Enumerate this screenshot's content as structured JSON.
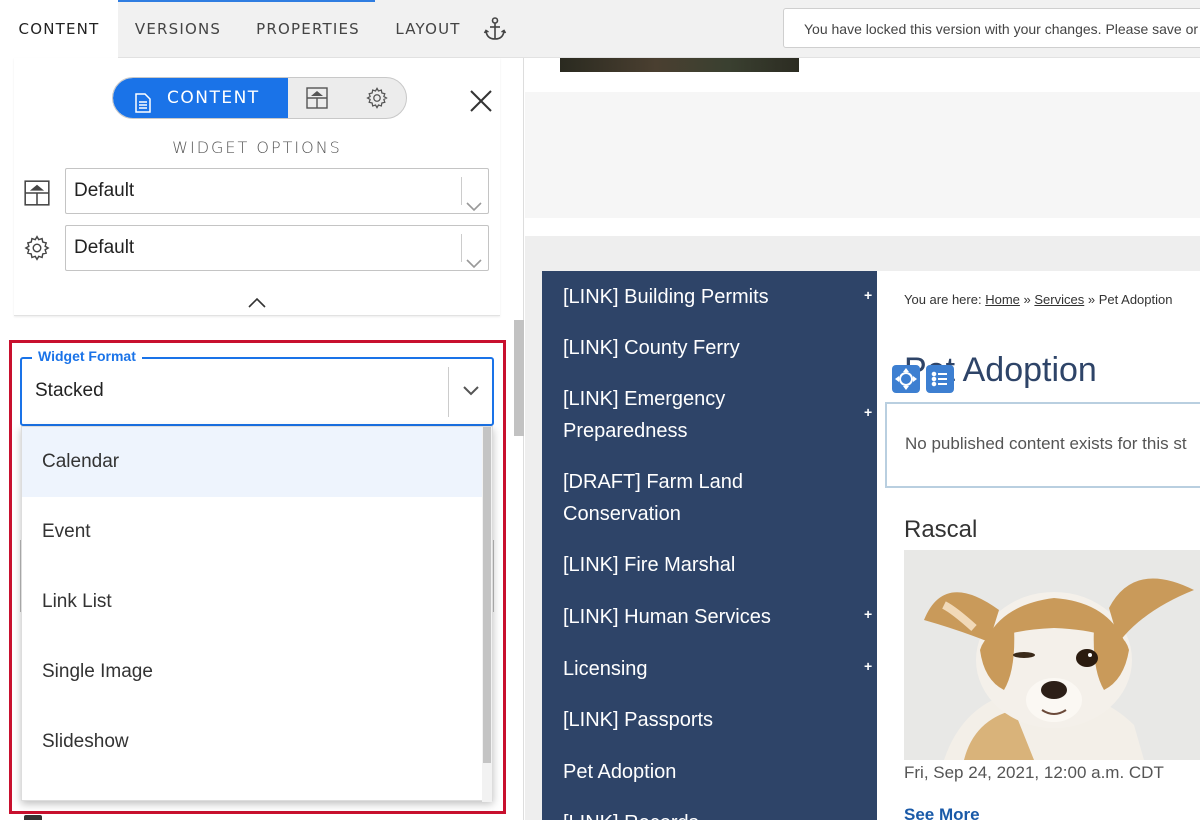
{
  "tabs": [
    {
      "label": "CONTENT"
    },
    {
      "label": "VERSIONS"
    },
    {
      "label": "PROPERTIES"
    },
    {
      "label": "LAYOUT"
    }
  ],
  "lock_message": "You have locked this version with your changes. Please save or",
  "panel": {
    "segment_content_label": "CONTENT",
    "widget_options_title": "WIDGET OPTIONS",
    "layout_select_value": "Default",
    "settings_select_value": "Default",
    "widget_format": {
      "legend": "Widget Format",
      "value": "Stacked",
      "options": [
        "Calendar",
        "Event",
        "Link List",
        "Single Image",
        "Slideshow"
      ],
      "highlighted": "Calendar"
    }
  },
  "site": {
    "nav": [
      {
        "label": "[LINK] Building Permits",
        "plus": "+"
      },
      {
        "label": "[LINK] County Ferry",
        "plus": ""
      },
      {
        "label": "[LINK] Emergency Preparedness",
        "plus": "+"
      },
      {
        "label": "[DRAFT] Farm Land Conservation",
        "plus": ""
      },
      {
        "label": "[LINK] Fire Marshal",
        "plus": ""
      },
      {
        "label": "[LINK] Human Services",
        "plus": "+"
      },
      {
        "label": "Licensing",
        "plus": "+"
      },
      {
        "label": "[LINK] Passports",
        "plus": ""
      },
      {
        "label": "Pet Adoption",
        "plus": ""
      },
      {
        "label": "[LINK] Records",
        "plus": ""
      }
    ],
    "breadcrumb": {
      "prefix": "You are here:",
      "home": "Home",
      "services": "Services",
      "current": "Pet Adoption",
      "sep": "»"
    },
    "page_title": "Pet Adoption",
    "notice": "No published content exists for this st",
    "pet_name": "Rascal",
    "pet_date": "Fri, Sep 24, 2021, 12:00 a.m. CDT",
    "see_more": "See More"
  },
  "colors": {
    "accent": "#1a73e8",
    "highlight_frame": "#c8102e",
    "nav_bg": "#2e4468",
    "edit_icon": "#3d7fd1"
  },
  "icons": [
    "anchor-icon",
    "document-icon",
    "layout-icon",
    "gear-icon",
    "close-icon",
    "chevron-down-icon",
    "chevron-up-icon",
    "move-icon",
    "list-icon"
  ]
}
